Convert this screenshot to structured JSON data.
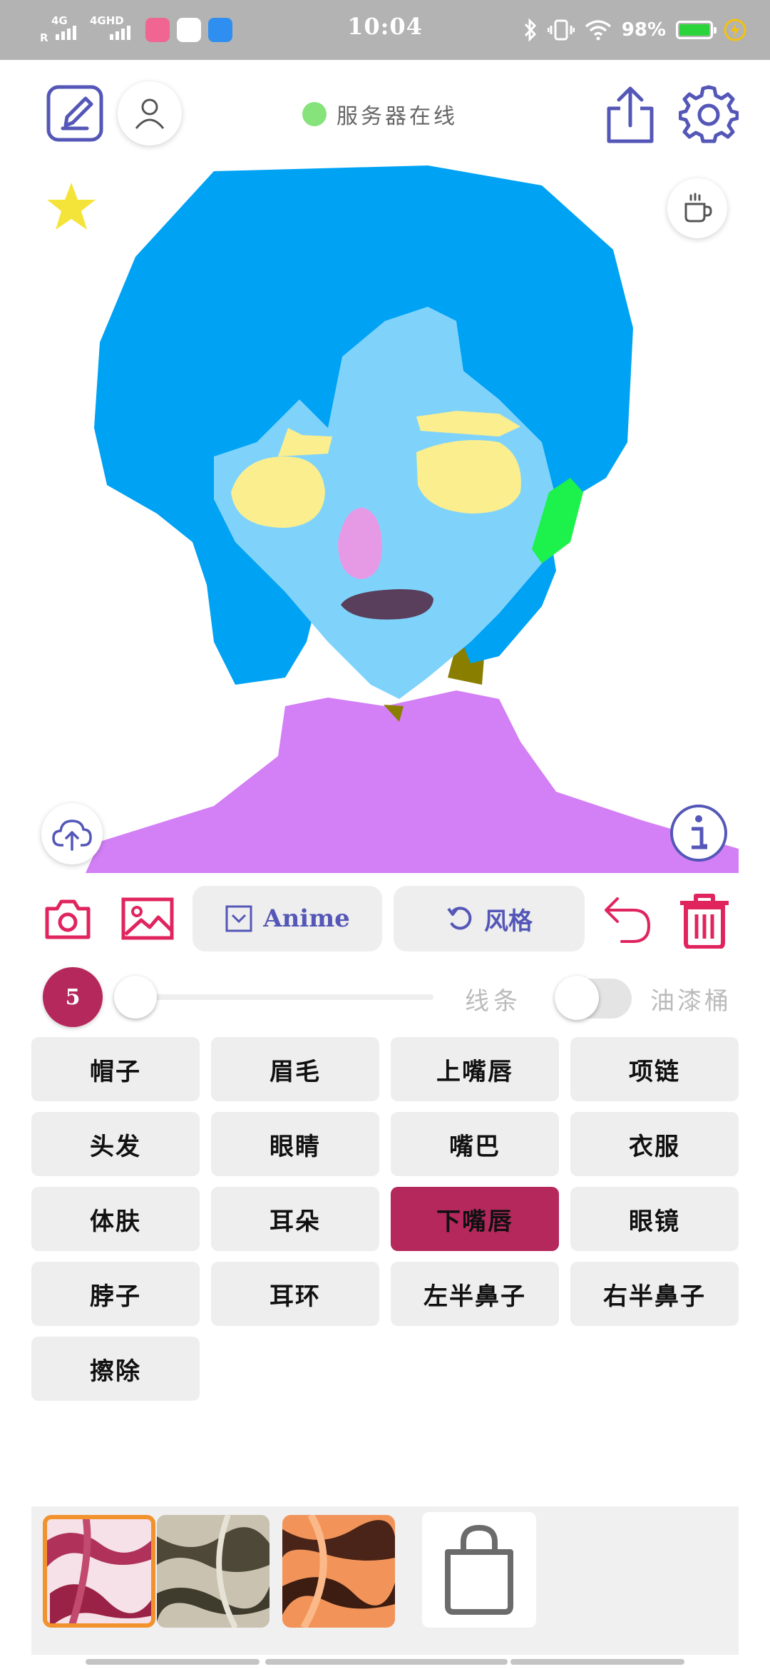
{
  "status_bar": {
    "sim1_label": "4G",
    "sim1_sub": "R",
    "sim2_label": "4GHD",
    "time": "10:04",
    "battery_percent": "98%",
    "icons": [
      "signal-icon",
      "app-icon-bilibili",
      "app-icon-cloud",
      "app-icon-qq",
      "bluetooth-icon",
      "vibrate-icon",
      "wifi-icon",
      "battery-icon",
      "charging-icon"
    ]
  },
  "header": {
    "server_status": "服务器在线",
    "server_status_color": "#86e37c",
    "accent_color": "#5457b7"
  },
  "toolbar": {
    "anime_label": "Anime",
    "style_label": "风格",
    "danger_color": "#e0245e"
  },
  "brush": {
    "size": "5",
    "size_slider_value": 0,
    "lines_label": "线条",
    "bucket_label": "油漆桶",
    "bucket_enabled": false
  },
  "parts": [
    {
      "label": "帽子",
      "active": false
    },
    {
      "label": "眉毛",
      "active": false
    },
    {
      "label": "上嘴唇",
      "active": false
    },
    {
      "label": "项链",
      "active": false
    },
    {
      "label": "头发",
      "active": false
    },
    {
      "label": "眼睛",
      "active": false
    },
    {
      "label": "嘴巴",
      "active": false
    },
    {
      "label": "衣服",
      "active": false
    },
    {
      "label": "体肤",
      "active": false
    },
    {
      "label": "耳朵",
      "active": false
    },
    {
      "label": "下嘴唇",
      "active": true
    },
    {
      "label": "眼镜",
      "active": false
    },
    {
      "label": "脖子",
      "active": false
    },
    {
      "label": "耳环",
      "active": false
    },
    {
      "label": "左半鼻子",
      "active": false
    },
    {
      "label": "右半鼻子",
      "active": false
    },
    {
      "label": "擦除",
      "active": false
    }
  ],
  "style_thumbnails": [
    {
      "name": "style-thumb-crimson",
      "selected": true
    },
    {
      "name": "style-thumb-olive",
      "selected": false
    },
    {
      "name": "style-thumb-orange",
      "selected": false
    }
  ],
  "active_color": "#b5285c"
}
